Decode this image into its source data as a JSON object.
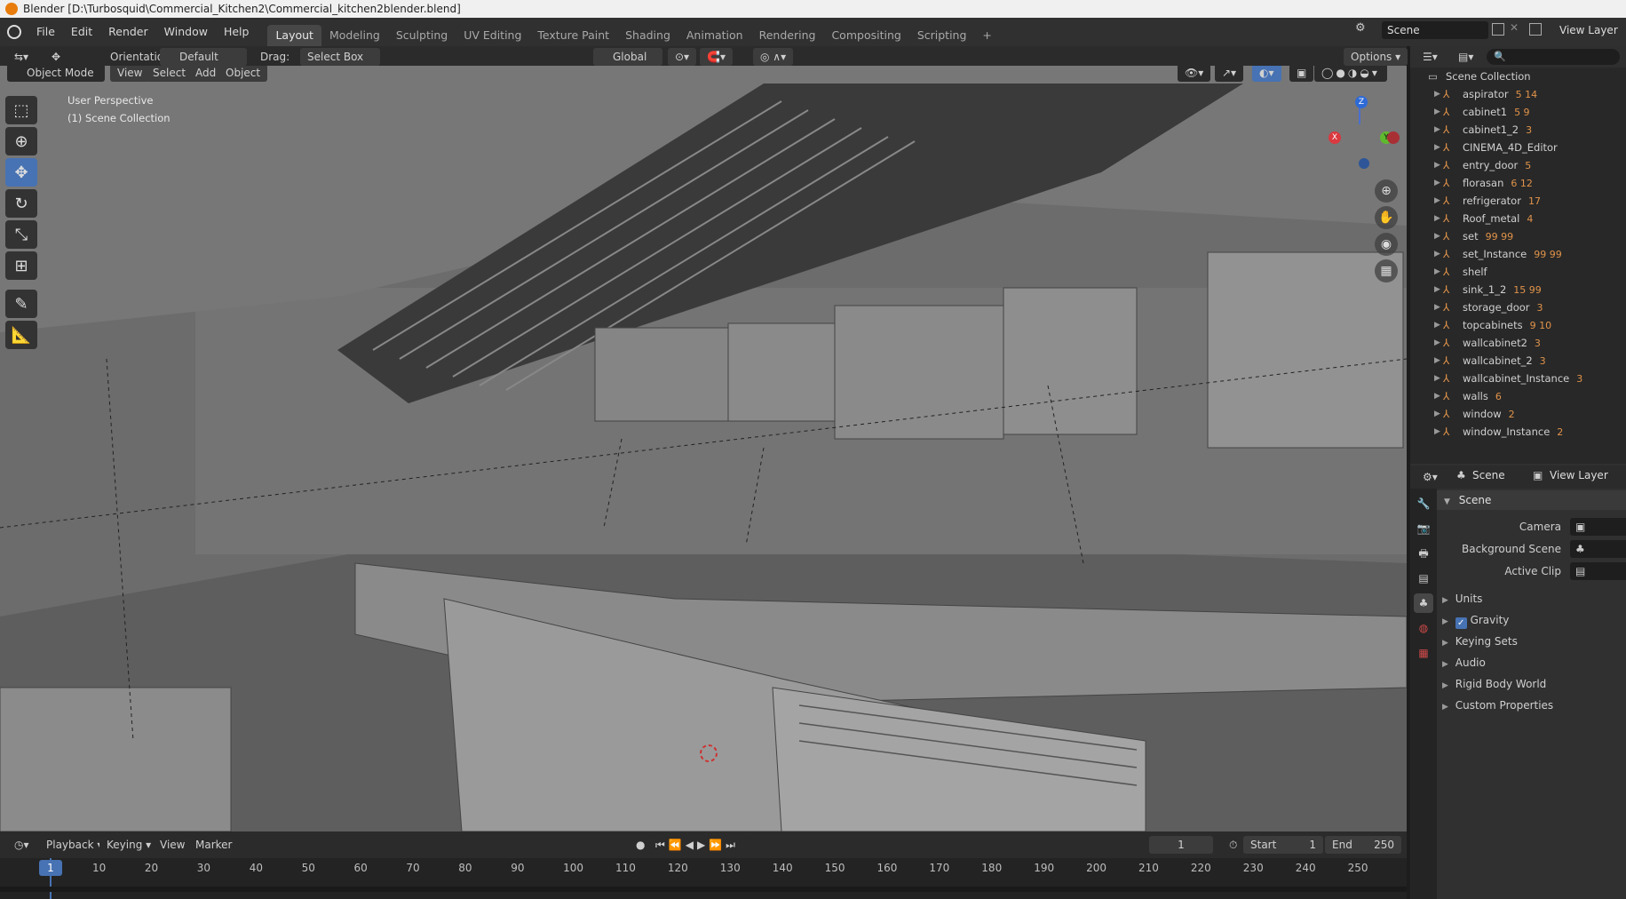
{
  "window_title": "Blender [D:\\Turbosquid\\Commercial_Kitchen2\\Commercial_kitchen2blender.blend]",
  "menu": [
    "File",
    "Edit",
    "Render",
    "Window",
    "Help"
  ],
  "workspaces": [
    "Layout",
    "Modeling",
    "Sculpting",
    "UV Editing",
    "Texture Paint",
    "Shading",
    "Animation",
    "Rendering",
    "Compositing",
    "Scripting",
    "+"
  ],
  "active_workspace": "Layout",
  "scene_field": "Scene",
  "view_layer_field": "View Layer",
  "tool_header": {
    "orientation_label": "Orientation:",
    "orientation_value": "Default",
    "drag_label": "Drag:",
    "drag_value": "Select Box",
    "transform_orientation": "Global",
    "options": "Options"
  },
  "viewport_header": {
    "mode": "Object Mode",
    "menus": [
      "View",
      "Select",
      "Add",
      "Object"
    ]
  },
  "viewport_overlay": {
    "perspective": "User Perspective",
    "collection": "(1) Scene Collection"
  },
  "gizmo_axes": {
    "x": "X",
    "y": "Y",
    "z": "Z"
  },
  "outliner": {
    "root": "Scene Collection",
    "items": [
      {
        "name": "aspirator",
        "extra": "5 14"
      },
      {
        "name": "cabinet1",
        "extra": "5 9"
      },
      {
        "name": "cabinet1_2",
        "extra": "3"
      },
      {
        "name": "CINEMA_4D_Editor",
        "extra": ""
      },
      {
        "name": "entry_door",
        "extra": "5"
      },
      {
        "name": "florasan",
        "extra": "6 12"
      },
      {
        "name": "refrigerator",
        "extra": "17"
      },
      {
        "name": "Roof_metal",
        "extra": "4"
      },
      {
        "name": "set",
        "extra": "99 99"
      },
      {
        "name": "set_Instance",
        "extra": "99 99"
      },
      {
        "name": "shelf",
        "extra": ""
      },
      {
        "name": "sink_1_2",
        "extra": "15 99"
      },
      {
        "name": "storage_door",
        "extra": "3"
      },
      {
        "name": "topcabinets",
        "extra": "9 10"
      },
      {
        "name": "wallcabinet2",
        "extra": "3"
      },
      {
        "name": "wallcabinet_2",
        "extra": "3"
      },
      {
        "name": "wallcabinet_Instance",
        "extra": "3"
      },
      {
        "name": "walls",
        "extra": "6"
      },
      {
        "name": "window",
        "extra": "2"
      },
      {
        "name": "window_Instance",
        "extra": "2"
      }
    ]
  },
  "properties": {
    "scene_tab": "Scene",
    "view_layer_tab": "View Layer",
    "panel_title": "Scene",
    "camera_label": "Camera",
    "background_scene_label": "Background Scene",
    "active_clip_label": "Active Clip",
    "sections": [
      "Units",
      "Gravity",
      "Keying Sets",
      "Audio",
      "Rigid Body World",
      "Custom Properties"
    ],
    "gravity_checked": true
  },
  "timeline": {
    "menus": [
      "Playback",
      "Keying",
      "View",
      "Marker"
    ],
    "current_frame": "1",
    "start_label": "Start",
    "start_value": "1",
    "end_label": "End",
    "end_value": "250",
    "ticks": [
      "1",
      "10",
      "20",
      "30",
      "40",
      "50",
      "60",
      "70",
      "80",
      "90",
      "100",
      "110",
      "120",
      "130",
      "140",
      "150",
      "160",
      "170",
      "180",
      "190",
      "200",
      "210",
      "220",
      "230",
      "240",
      "250"
    ]
  },
  "colors": {
    "accent": "#4772b3",
    "object_icon": "#e0934a",
    "viewport_bg": "#6e6e6e",
    "panel_bg": "#303030"
  }
}
